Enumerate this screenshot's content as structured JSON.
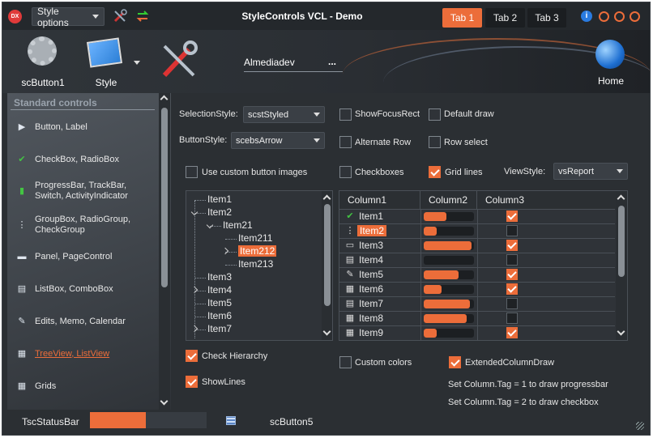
{
  "app": {
    "title": "StyleControls VCL - Demo",
    "style_options": "Style options",
    "tabs": [
      "Tab 1",
      "Tab 2",
      "Tab 3"
    ],
    "active_tab": 0,
    "logo_text": "DX"
  },
  "colors": {
    "accent": "#ec6d3a",
    "background": "#2b2f33",
    "sidebar": "#41464c"
  },
  "ribbon": {
    "button1": "scButton1",
    "style": "Style",
    "edit_value": "Almediadev",
    "edit_ellipsis": "...",
    "home": "Home"
  },
  "sidebar": {
    "header": "Standard controls",
    "items": [
      {
        "label": "Button, Label",
        "icon": "play-icon"
      },
      {
        "label": "CheckBox, RadioBox",
        "icon": "check-icon"
      },
      {
        "label": "ProgressBar, TrackBar, Switch, ActivityIndicator",
        "icon": "signal-bars-icon"
      },
      {
        "label": "GroupBox, RadioGroup, CheckGroup",
        "icon": "list-icon"
      },
      {
        "label": "Panel, PageControl",
        "icon": "panel-icon"
      },
      {
        "label": "ListBox, ComboBox",
        "icon": "listbox-icon"
      },
      {
        "label": "Edits, Memo, Calendar",
        "icon": "edit-icon"
      },
      {
        "label": "TreeView, ListView",
        "icon": "treeview-icon",
        "selected": true
      },
      {
        "label": "Grids",
        "icon": "grid-icon"
      }
    ]
  },
  "options": {
    "selection_style_label": "SelectionStyle:",
    "selection_style_value": "scstStyled",
    "button_style_label": "ButtonStyle:",
    "button_style_value": "scebsArrow",
    "show_focus_rect": "ShowFocusRect",
    "default_draw": "Default draw",
    "alternate_row": "Alternate Row",
    "row_select": "Row select",
    "use_custom_button_images": "Use custom button images",
    "checkboxes": "Checkboxes",
    "grid_lines": "Grid lines",
    "view_style_label": "ViewStyle:",
    "view_style_value": "vsReport",
    "check_hierarchy": "Check Hierarchy",
    "show_lines": "ShowLines",
    "custom_colors": "Custom colors",
    "extended_column_draw": "ExtendedColumnDraw",
    "note1": "Set Column.Tag = 1 to draw progressbar",
    "note2": "Set Column.Tag = 2 to draw checkbox"
  },
  "checks": {
    "show_focus_rect": false,
    "default_draw": false,
    "alternate_row": false,
    "row_select": false,
    "use_custom_button_images": false,
    "checkboxes": false,
    "grid_lines": true,
    "check_hierarchy": true,
    "show_lines": true,
    "custom_colors": false,
    "extended_column_draw": true
  },
  "tree": [
    {
      "label": "Item1",
      "level": 0
    },
    {
      "label": "Item2",
      "level": 0,
      "expanded": true
    },
    {
      "label": "Item21",
      "level": 1,
      "expanded": true
    },
    {
      "label": "Item211",
      "level": 2
    },
    {
      "label": "Item212",
      "level": 2,
      "selected": true,
      "collapsed_arrow": true
    },
    {
      "label": "Item213",
      "level": 2
    },
    {
      "label": "Item3",
      "level": 0
    },
    {
      "label": "Item4",
      "level": 0,
      "collapsed_arrow": true
    },
    {
      "label": "Item5",
      "level": 0
    },
    {
      "label": "Item6",
      "level": 0
    },
    {
      "label": "Item7",
      "level": 0,
      "collapsed_arrow": true
    }
  ],
  "grid": {
    "columns": [
      "Column1",
      "Column2",
      "Column3"
    ],
    "rows": [
      {
        "label": "Item1",
        "icon": "check-icon",
        "progress": 0.45,
        "checked": true
      },
      {
        "label": "Item2",
        "icon": "list-icon",
        "progress": 0.25,
        "checked": false,
        "selected": true
      },
      {
        "label": "Item3",
        "icon": "printer-icon",
        "progress": 0.95,
        "checked": true
      },
      {
        "label": "Item4",
        "icon": "listbox-icon",
        "progress": 0.0,
        "checked": false
      },
      {
        "label": "Item5",
        "icon": "edit-icon",
        "progress": 0.7,
        "checked": true
      },
      {
        "label": "Item6",
        "icon": "calendar-icon",
        "progress": 0.35,
        "checked": true
      },
      {
        "label": "Item7",
        "icon": "table-icon",
        "progress": 0.92,
        "checked": false
      },
      {
        "label": "Item8",
        "icon": "grid-icon",
        "progress": 0.85,
        "checked": false
      },
      {
        "label": "Item9",
        "icon": "grid-icon",
        "progress": 0.25,
        "checked": true
      }
    ]
  },
  "statusbar": {
    "label": "TscStatusBar",
    "progress": 0.48,
    "button": "scButton5"
  }
}
